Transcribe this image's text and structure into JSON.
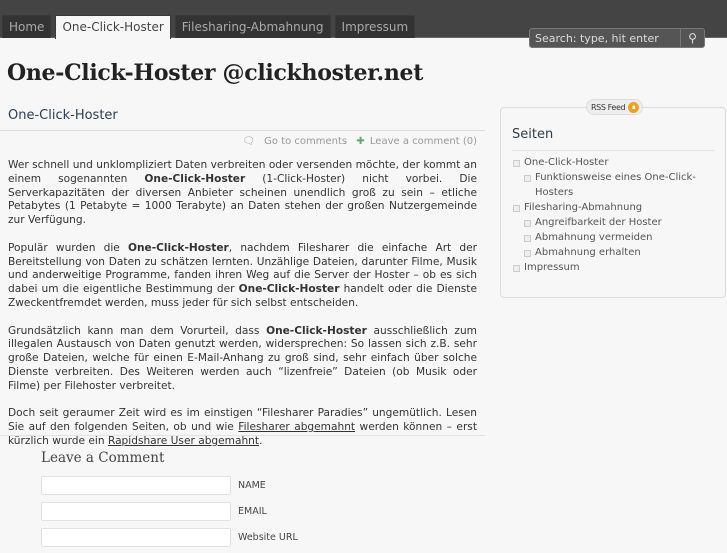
{
  "nav": {
    "tabs": [
      {
        "label": "Home"
      },
      {
        "label": "One-Click-Hoster"
      },
      {
        "label": "Filesharing-Abmahnung"
      },
      {
        "label": "Impressum"
      }
    ],
    "search_placeholder": "Search: type, hit enter"
  },
  "site_title": "One-Click-Hoster @clickhoster.net",
  "post": {
    "title": "One-Click-Hoster",
    "go_to_comments": "Go to comments",
    "leave_comment": "Leave a comment (0)",
    "paragraphs": [
      [
        {
          "t": "Wer schnell und unklompliziert Daten verbreiten oder versenden möchte, der kommt an einem sogenannten "
        },
        {
          "b": "One-Click-Hoster"
        },
        {
          "t": " (1-Click-Hoster) nicht vorbei. Die Serverkapazitäten der diversen Anbieter scheinen unendlich groß zu sein – etliche Petabytes (1 Petabyte = 1000 Terabyte) an Daten stehen der großen Nutzergemeinde zur Verfügung."
        }
      ],
      [
        {
          "t": "Populär wurden die "
        },
        {
          "b": "One-Click-Hoster"
        },
        {
          "t": ", nachdem Filesharer die einfache Art der Bereitstellung von Daten zu schätzen lernten. Unzählige Dateien, darunter Filme, Musik und anderweitige Programme, fanden ihren Weg auf die Server der Hoster – ob es sich dabei um die eigentliche Bestimmung der "
        },
        {
          "b": "One-Click-Hoster"
        },
        {
          "t": " handelt oder die Dienste Zweckentfremdet werden, muss jeder für sich selbst entscheiden."
        }
      ],
      [
        {
          "t": "Grundsätzlich kann man dem Vorurteil, dass "
        },
        {
          "b": "One-Click-Hoster"
        },
        {
          "t": " ausschließlich zum illegalen Austausch von Daten genutzt werden, widersprechen: So lassen sich z.B. sehr große Dateien, welche für einen E-Mail-Anhang zu groß sind, sehr einfach über solche Dienste verbreiten. Des Weiteren werden auch “lizenfreie” Dateien (ob Musik oder Filme) per Filehoster verbreitet."
        }
      ],
      [
        {
          "t": "Doch seit geraumer Zeit wird es im einstigen “Filesharer Paradies” ungemütlich. Lesen Sie auf den folgenden Seiten, ob und wie "
        },
        {
          "a": "Filesharer abgemahnt"
        },
        {
          "t": " werden können – erst kürzlich wurde ein "
        },
        {
          "a": "Rapidshare User abgemahnt"
        },
        {
          "t": "."
        }
      ]
    ]
  },
  "comment_form": {
    "heading": "Leave a Comment",
    "name_label": "NAME",
    "email_label": "EMAIL",
    "url_label": "Website URL"
  },
  "sidebar": {
    "rss": "RSS Feed",
    "heading": "Seiten",
    "items": [
      {
        "label": "One-Click-Hoster",
        "sub": false
      },
      {
        "label": "Funktionsweise eines One-Click-Hosters",
        "sub": true
      },
      {
        "label": "Filesharing-Abmahnung",
        "sub": false
      },
      {
        "label": "Angreifbarkeit der Hoster",
        "sub": true
      },
      {
        "label": "Abmahnung vermeiden",
        "sub": true
      },
      {
        "label": "Abmahnung erhalten",
        "sub": true
      },
      {
        "label": "Impressum",
        "sub": false
      }
    ]
  }
}
